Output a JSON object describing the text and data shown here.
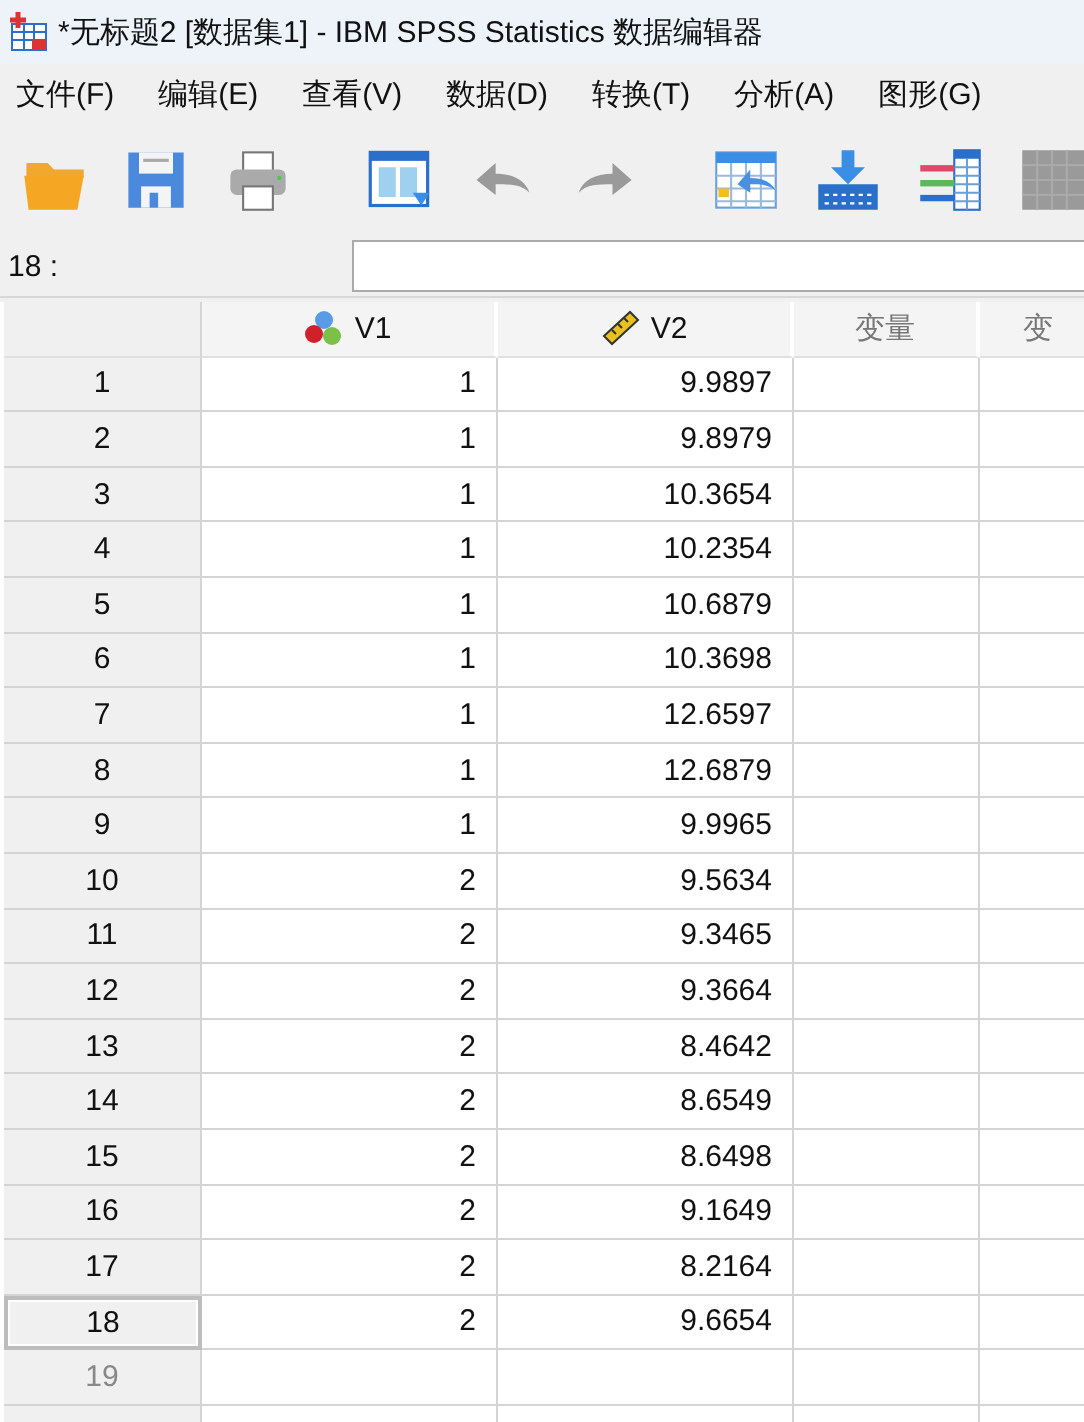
{
  "window": {
    "title": "*无标题2 [数据集1] - IBM SPSS Statistics 数据编辑器"
  },
  "menu": [
    "文件(F)",
    "编辑(E)",
    "查看(V)",
    "数据(D)",
    "转换(T)",
    "分析(A)",
    "图形(G)"
  ],
  "toolbar": [
    {
      "kind": "open",
      "disabled": false
    },
    {
      "kind": "save",
      "disabled": false
    },
    {
      "kind": "print",
      "disabled": false
    },
    {
      "kind": "dialog",
      "disabled": false
    },
    {
      "kind": "undo",
      "disabled": true
    },
    {
      "kind": "redo",
      "disabled": true
    },
    {
      "kind": "goto-case",
      "disabled": false
    },
    {
      "kind": "goto-variable",
      "disabled": false
    },
    {
      "kind": "variables",
      "disabled": false
    },
    {
      "kind": "table",
      "disabled": true
    }
  ],
  "cell_editor": {
    "label": "18 :"
  },
  "columns": [
    {
      "name": "V1",
      "kind": "nominal"
    },
    {
      "name": "V2",
      "kind": "scale"
    },
    {
      "name": "变量",
      "kind": "empty"
    },
    {
      "name": "变",
      "kind": "empty"
    }
  ],
  "rows": [
    {
      "label": "1",
      "kind": "case",
      "selected": false,
      "cells": [
        "1",
        "9.9897"
      ]
    },
    {
      "label": "2",
      "kind": "case",
      "selected": false,
      "cells": [
        "1",
        "9.8979"
      ]
    },
    {
      "label": "3",
      "kind": "case",
      "selected": false,
      "cells": [
        "1",
        "10.3654"
      ]
    },
    {
      "label": "4",
      "kind": "case",
      "selected": false,
      "cells": [
        "1",
        "10.2354"
      ]
    },
    {
      "label": "5",
      "kind": "case",
      "selected": false,
      "cells": [
        "1",
        "10.6879"
      ]
    },
    {
      "label": "6",
      "kind": "case",
      "selected": false,
      "cells": [
        "1",
        "10.3698"
      ]
    },
    {
      "label": "7",
      "kind": "case",
      "selected": false,
      "cells": [
        "1",
        "12.6597"
      ]
    },
    {
      "label": "8",
      "kind": "case",
      "selected": false,
      "cells": [
        "1",
        "12.6879"
      ]
    },
    {
      "label": "9",
      "kind": "case",
      "selected": false,
      "cells": [
        "1",
        "9.9965"
      ]
    },
    {
      "label": "10",
      "kind": "case",
      "selected": false,
      "cells": [
        "2",
        "9.5634"
      ]
    },
    {
      "label": "11",
      "kind": "case",
      "selected": false,
      "cells": [
        "2",
        "9.3465"
      ]
    },
    {
      "label": "12",
      "kind": "case",
      "selected": false,
      "cells": [
        "2",
        "9.3664"
      ]
    },
    {
      "label": "13",
      "kind": "case",
      "selected": false,
      "cells": [
        "2",
        "8.4642"
      ]
    },
    {
      "label": "14",
      "kind": "case",
      "selected": false,
      "cells": [
        "2",
        "8.6549"
      ]
    },
    {
      "label": "15",
      "kind": "case",
      "selected": false,
      "cells": [
        "2",
        "8.6498"
      ]
    },
    {
      "label": "16",
      "kind": "case",
      "selected": false,
      "cells": [
        "2",
        "9.1649"
      ]
    },
    {
      "label": "17",
      "kind": "case",
      "selected": false,
      "cells": [
        "2",
        "8.2164"
      ]
    },
    {
      "label": "18",
      "kind": "case",
      "selected": true,
      "cells": [
        "2",
        "9.6654"
      ]
    },
    {
      "label": "19",
      "kind": "empty",
      "selected": false,
      "cells": []
    }
  ]
}
